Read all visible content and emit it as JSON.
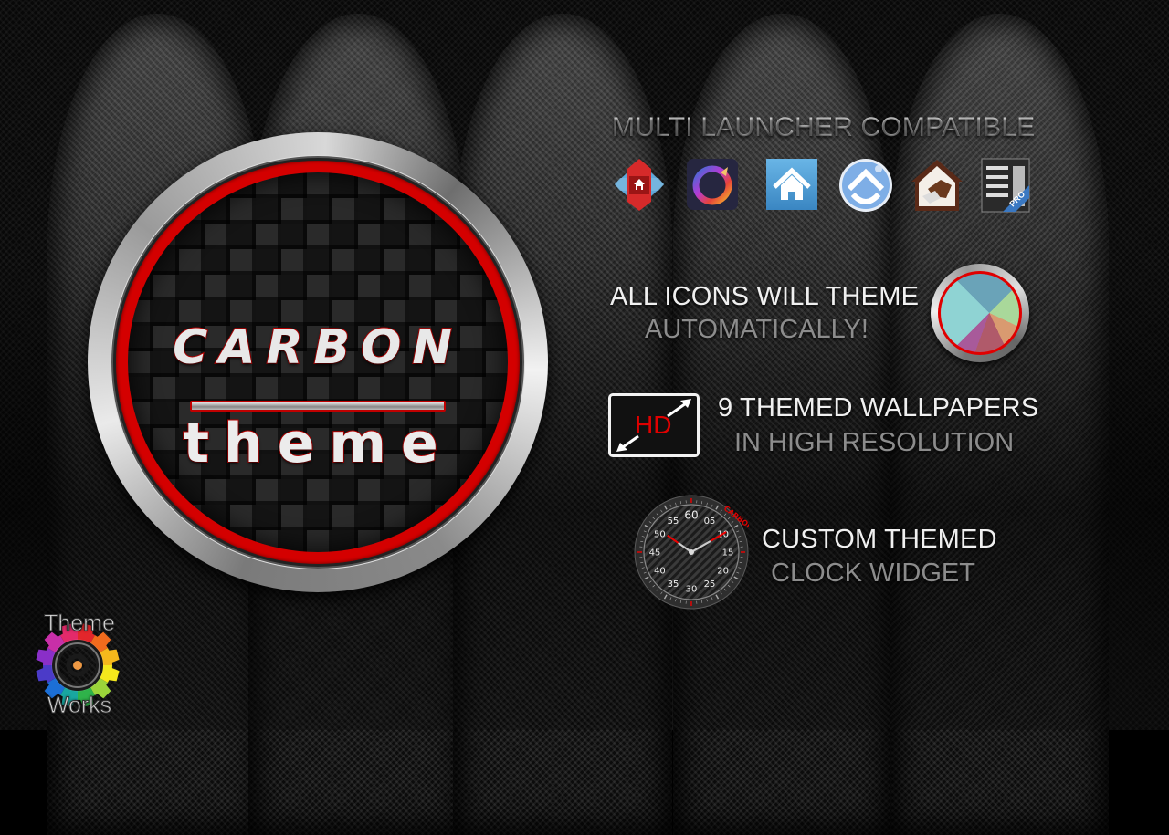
{
  "emblem": {
    "title": "CARBON",
    "subtitle": "theme"
  },
  "features": {
    "launchers": {
      "heading": "MULTI LAUNCHER COMPATIBLE",
      "icons": [
        {
          "name": "nova-launcher-icon"
        },
        {
          "name": "apex-launcher-icon"
        },
        {
          "name": "home-launcher-icon"
        },
        {
          "name": "adw-launcher-icon"
        },
        {
          "name": "holo-launcher-icon"
        },
        {
          "name": "lightning-launcher-pro-icon",
          "badge": "PRO"
        }
      ]
    },
    "auto_theme": {
      "line1": "ALL ICONS WILL THEME",
      "line2": "AUTOMATICALLY!"
    },
    "wallpapers": {
      "badge": "HD",
      "line1": "9 THEMED WALLPAPERS",
      "line2": "IN HIGH RESOLUTION"
    },
    "clock": {
      "line1": "CUSTOM THEMED",
      "line2": "CLOCK WIDGET",
      "brand": "CARBON",
      "dial_numbers": [
        "60",
        "05",
        "10",
        "15",
        "20",
        "25",
        "30",
        "35",
        "40",
        "45",
        "50",
        "55"
      ],
      "time": {
        "hour": 10,
        "minute": 10
      }
    }
  },
  "logo": {
    "top_text": "Theme",
    "bottom_text": "Works"
  },
  "colors": {
    "accent_red": "#d40000",
    "chrome": "#d8d8d8",
    "headline": "#f0f0f0",
    "subline": "#8c8c8c",
    "background": "#080808"
  }
}
